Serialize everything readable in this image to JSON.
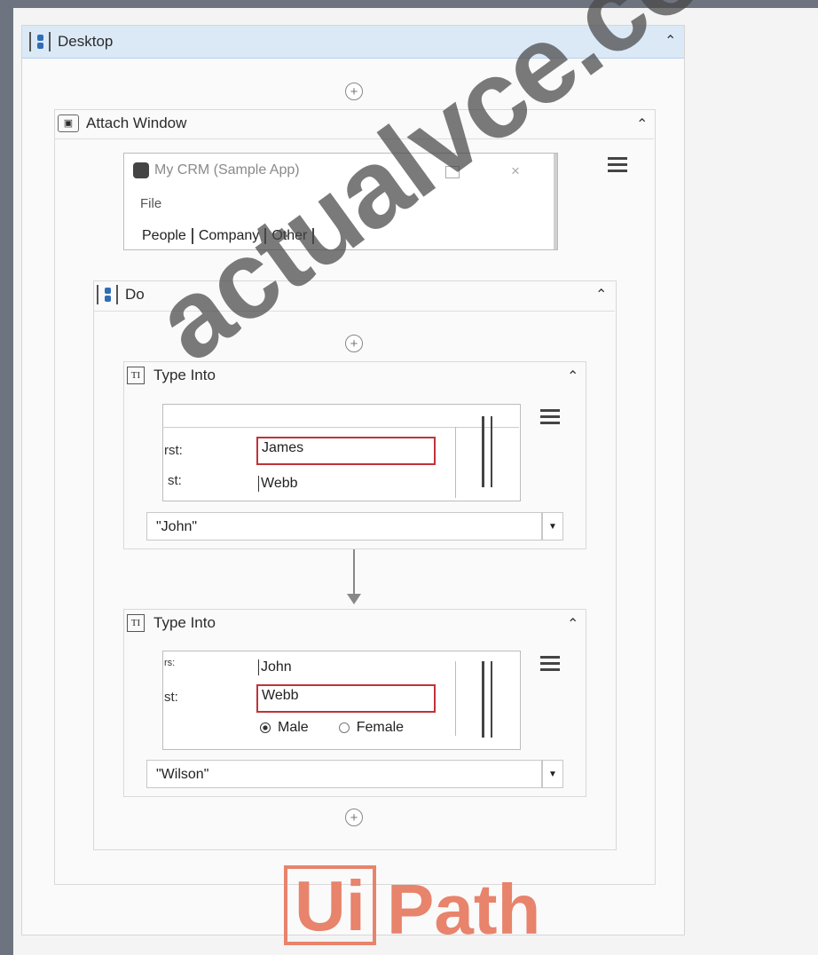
{
  "desktop": {
    "title": "Desktop"
  },
  "attach_window": {
    "title": "Attach Window",
    "app": {
      "title": "My CRM (Sample App)",
      "menu": "File",
      "tabs": [
        "People",
        "Company",
        "Other"
      ]
    }
  },
  "do": {
    "title": "Do"
  },
  "type_into_1": {
    "title": "Type Into",
    "label_first": "rst:",
    "label_last": "st:",
    "first_value": "James",
    "last_value": "Webb",
    "text_value": "\"John\""
  },
  "type_into_2": {
    "title": "Type Into",
    "label_first": "rs:",
    "label_last": "st:",
    "first_value": "John",
    "last_value": "Webb",
    "gender_male": "Male",
    "gender_female": "Female",
    "text_value": "\"Wilson\""
  },
  "watermark": "actualvce.com",
  "logo": {
    "part1": "Ui",
    "part2": "Path"
  }
}
